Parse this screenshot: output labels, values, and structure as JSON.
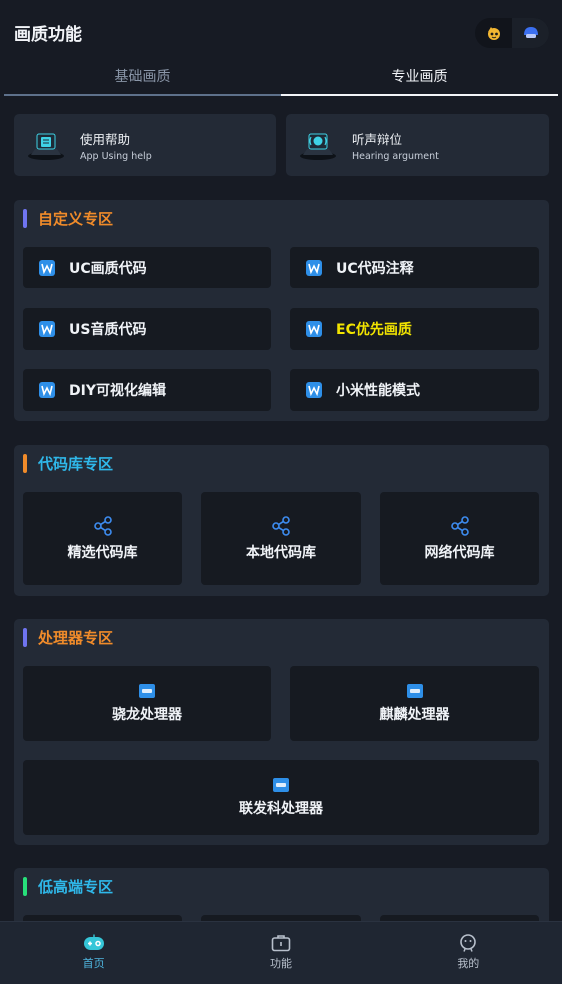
{
  "header": {
    "title": "画质功能"
  },
  "tabs": [
    {
      "label": "基础画质"
    },
    {
      "label": "专业画质"
    }
  ],
  "help_cards": [
    {
      "title": "使用帮助",
      "subtitle": "App Using help"
    },
    {
      "title": "听声辩位",
      "subtitle": "Hearing argument"
    }
  ],
  "sections": {
    "custom": {
      "title": "自定义专区",
      "bar_color": "#6f74f0",
      "title_color": "#f08b2a",
      "items": [
        {
          "label": "UC画质代码"
        },
        {
          "label": "UC代码注释"
        },
        {
          "label": "US音质代码"
        },
        {
          "label": "EC优先画质",
          "color": "#f2e400"
        },
        {
          "label": "DIY可视化编辑"
        },
        {
          "label": "小米性能模式"
        }
      ]
    },
    "codelib": {
      "title": "代码库专区",
      "bar_color": "#f08b2a",
      "title_color": "#2fb8ea",
      "items": [
        {
          "label": "精选代码库"
        },
        {
          "label": "本地代码库"
        },
        {
          "label": "网络代码库"
        }
      ]
    },
    "processor": {
      "title": "处理器专区",
      "bar_color": "#6f74f0",
      "title_color": "#f08b2a",
      "items": [
        {
          "label": "骁龙处理器"
        },
        {
          "label": "麒麟处理器"
        },
        {
          "label": "联发科处理器"
        }
      ]
    },
    "lowhigh": {
      "title": "低高端专区",
      "bar_color": "#27e07a",
      "title_color": "#2fb8ea"
    }
  },
  "bottom_nav": [
    {
      "label": "首页",
      "icon": "home-icon",
      "active": true
    },
    {
      "label": "功能",
      "icon": "toolbox-icon",
      "active": false
    },
    {
      "label": "我的",
      "icon": "profile-icon",
      "active": false
    }
  ],
  "colors": {
    "background": "#171b24",
    "card": "#232a36",
    "item": "#161a21",
    "accent": "#4fb7e0"
  }
}
